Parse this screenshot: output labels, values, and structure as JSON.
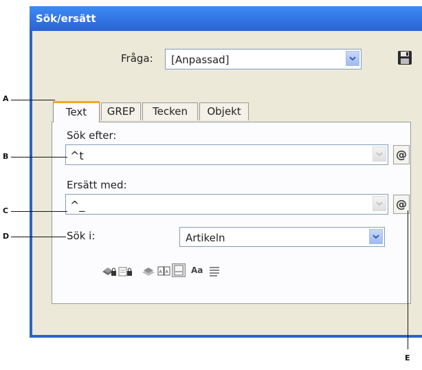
{
  "window": {
    "title": "Sök/ersätt"
  },
  "query": {
    "label": "Fråga:",
    "value": "[Anpassad]"
  },
  "tabs": [
    {
      "label": "Text",
      "active": true
    },
    {
      "label": "GREP",
      "active": false
    },
    {
      "label": "Tecken",
      "active": false
    },
    {
      "label": "Objekt",
      "active": false
    }
  ],
  "find": {
    "label": "Sök efter:",
    "value": "^t"
  },
  "replace": {
    "label": "Ersätt med:",
    "value": "^_"
  },
  "search_in": {
    "label": "Sök i:",
    "value": "Artikeln"
  },
  "options": {
    "case_label": "Aa"
  },
  "callouts": {
    "a": "A",
    "b": "B",
    "c": "C",
    "d": "D",
    "e": "E"
  },
  "special_char_symbol": "@",
  "colors": {
    "title_bar": "#2a62d6",
    "dialog_bg": "#ece9d8",
    "active_tab_accent": "#f5a623",
    "dropdown_arrow": "#3a5fb0"
  }
}
